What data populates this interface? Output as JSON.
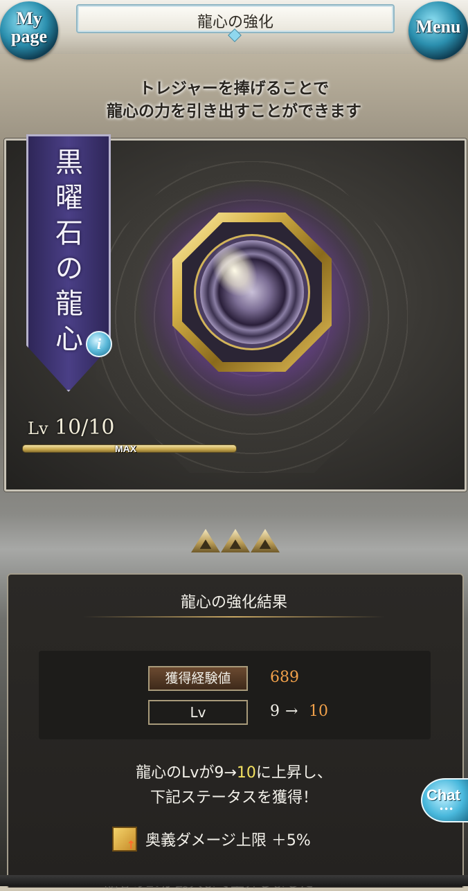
{
  "header": {
    "title": "龍心の強化",
    "mypage_line1": "My",
    "mypage_line2": "page",
    "menu_label": "Menu"
  },
  "intro": {
    "line1": "トレジャーを捧げることで",
    "line2": "龍心の力を引き出すことができます"
  },
  "item": {
    "name_chars": [
      "黒",
      "曜",
      "石",
      "の",
      "龍",
      "心"
    ],
    "info_label": "i",
    "level_prefix": "Lv",
    "level_value": "10/10",
    "level_fraction": 1.0,
    "max_label": "MAX"
  },
  "result": {
    "title": "龍心の強化結果",
    "exp_label": "獲得経験値",
    "exp_value": "689",
    "lv_label": "Lv",
    "lv_from": "9",
    "lv_arrow": "→",
    "lv_to": "10",
    "message_line1_pre": "龍心のLvが9→",
    "message_line1_num": "10",
    "message_line1_post": "に上昇し、",
    "message_line2": "下記ステータスを獲得！",
    "bonus": "奥義ダメージ上限 ＋5%",
    "bottom_partial": "龍心のLvが最大まで上昇しました"
  },
  "chat": {
    "label": "Chat",
    "dots": "•••"
  }
}
